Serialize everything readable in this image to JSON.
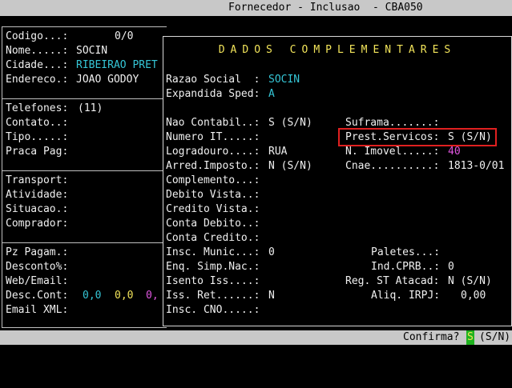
{
  "window": {
    "title": "Fornecedor - Inclusao  - CBA050"
  },
  "left_panel": {
    "codigo_label": "Codigo...:",
    "codigo_value": "0/0",
    "nome_label": "Nome.....:",
    "nome_value": "SOCIN",
    "cidade_label": "Cidade...:",
    "cidade_value": "RIBEIRAO PRET",
    "endereco_label": "Endereco.:",
    "endereco_value": "JOAO GODOY",
    "telefones_label": "Telefones:",
    "telefones_value": "(11)",
    "contato_label": "Contato..:",
    "tipo_label": "Tipo.....:",
    "praca_label": "Praca Pag:",
    "transport_label": "Transport:",
    "atividade_label": "Atividade:",
    "situacao_label": "Situacao.:",
    "comprador_label": "Comprador:",
    "pz_pagam_label": "Pz Pagam.:",
    "desconto_label": "Desconto%:",
    "web_email_label": "Web/Email:",
    "desc_cont_label": "Desc.Cont:",
    "desc_cont_v1": "0,0",
    "desc_cont_v2": "0,0",
    "desc_cont_v3": "0,",
    "email_xml_label": "Email XML:"
  },
  "dialog": {
    "title": "DADOS COMPLEMENTARES",
    "razao_social_label": "Razao Social  :",
    "razao_social_value": "SOCIN",
    "expandida_label": "Expandida Sped:",
    "expandida_value": "A",
    "nao_contabil_label": "Nao Contabil..:",
    "nao_contabil_value": "S (S/N)",
    "numero_it_label": "Numero IT.....:",
    "logradouro_label": "Logradouro....:",
    "logradouro_value": "RUA",
    "arred_label": "Arred.Imposto.:",
    "arred_value": "N (S/N)",
    "complemento_label": "Complemento...:",
    "debito_vista_label": "Debito Vista..:",
    "credito_vista_label": "Credito Vista.:",
    "conta_debito_label": "Conta Debito..:",
    "conta_credito_label": "Conta Credito.:",
    "insc_munic_label": "Insc. Munic...:",
    "insc_munic_value": "0",
    "enq_simp_label": "Enq. Simp.Nac.:",
    "isento_iss_label": "Isento Iss....:",
    "iss_ret_label": "Iss. Ret......:",
    "iss_ret_value": "N",
    "insc_cno_label": "Insc. CNO.....:",
    "suframa_label": "Suframa.......:",
    "prest_servicos_label": "Prest.Servicos:",
    "prest_servicos_value": "S (S/N)",
    "n_imovel_label": "N. Imovel.....:",
    "n_imovel_value": "40",
    "cnae_label": "Cnae..........:",
    "cnae_value": "1813-0/01",
    "paletes_label": "Paletes...:",
    "ind_cprb_label": "Ind.CPRB..:",
    "ind_cprb_value": "0",
    "reg_st_label": "Reg. ST Atacad:",
    "reg_st_value": "N (S/N)",
    "aliq_irpj_label": "Aliq. IRPJ:",
    "aliq_irpj_value": "0,00"
  },
  "status": {
    "confirma_label": "Confirma?",
    "confirma_value": "S",
    "confirma_options": "(S/N)"
  },
  "colors": {
    "background": "#000000",
    "label": "#f0f0f0",
    "value_cyan": "#35c6d6",
    "value_yellow": "#f2e45a",
    "value_magenta": "#e056e0",
    "highlight_red": "#e02020",
    "bar_gray": "#c8c8c8",
    "confirm_green": "#1fb31f"
  }
}
